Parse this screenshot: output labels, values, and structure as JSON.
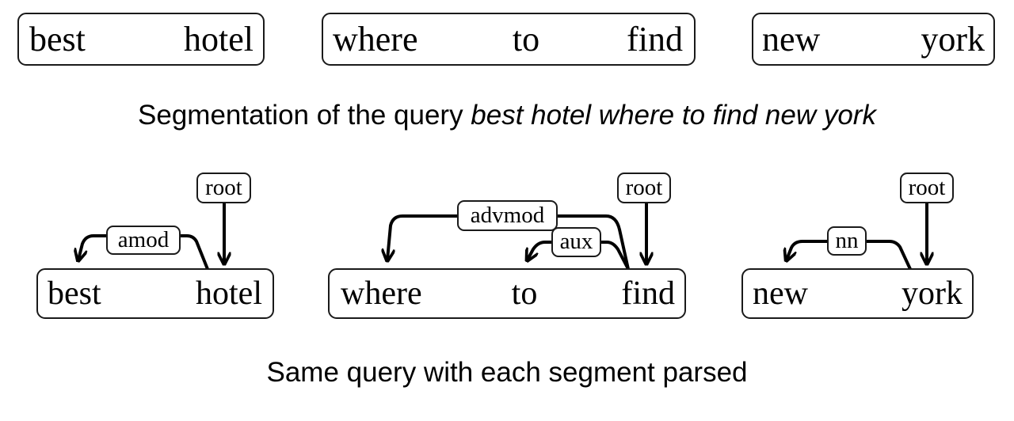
{
  "query": "best hotel where to find new york",
  "segmentation": {
    "segments": [
      {
        "words": [
          "best",
          "hotel"
        ]
      },
      {
        "words": [
          "where",
          "to",
          "find"
        ]
      },
      {
        "words": [
          "new",
          "york"
        ]
      }
    ],
    "caption_prefix": "Segmentation of the query ",
    "caption_query": "best hotel where to find new york"
  },
  "parsed": {
    "segments": [
      {
        "words": [
          "best",
          "hotel"
        ],
        "root_label": "root",
        "root_word": "hotel",
        "dependencies": [
          {
            "label": "amod",
            "head": "hotel",
            "dependent": "best"
          }
        ]
      },
      {
        "words": [
          "where",
          "to",
          "find"
        ],
        "root_label": "root",
        "root_word": "find",
        "dependencies": [
          {
            "label": "advmod",
            "head": "find",
            "dependent": "where"
          },
          {
            "label": "aux",
            "head": "find",
            "dependent": "to"
          }
        ]
      },
      {
        "words": [
          "new",
          "york"
        ],
        "root_label": "root",
        "root_word": "york",
        "dependencies": [
          {
            "label": "nn",
            "head": "york",
            "dependent": "new"
          }
        ]
      }
    ],
    "caption": "Same query with each segment parsed"
  }
}
